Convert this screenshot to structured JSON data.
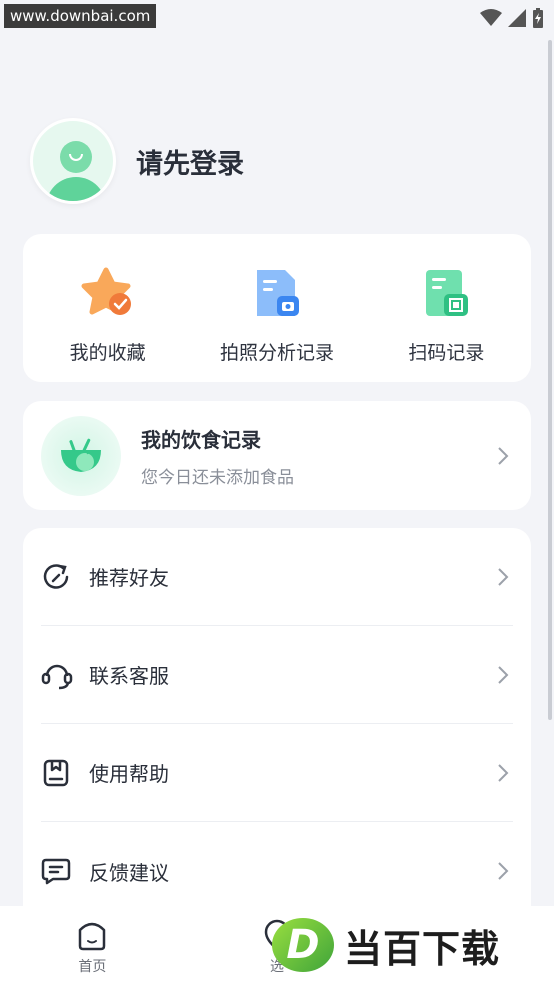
{
  "watermark_top": "www.downbai.com",
  "profile": {
    "login_text": "请先登录"
  },
  "shortcuts": [
    {
      "label": "我的收藏",
      "icon": "star-check-icon"
    },
    {
      "label": "拍照分析记录",
      "icon": "photo-doc-icon"
    },
    {
      "label": "扫码记录",
      "icon": "scan-doc-icon"
    }
  ],
  "diet": {
    "title": "我的饮食记录",
    "subtitle": "您今日还未添加食品",
    "icon": "food-bowl-icon"
  },
  "menu": [
    {
      "label": "推荐好友",
      "icon": "share-refresh-icon"
    },
    {
      "label": "联系客服",
      "icon": "headset-icon"
    },
    {
      "label": "使用帮助",
      "icon": "bookmark-book-icon"
    },
    {
      "label": "反馈建议",
      "icon": "message-icon"
    }
  ],
  "bottom_nav": [
    {
      "label": "首页",
      "icon": "home-face-icon"
    },
    {
      "label": "选",
      "icon": "location-icon"
    }
  ],
  "watermark_bottom": {
    "logo": "D",
    "text": "当百下载"
  },
  "colors": {
    "accent_green": "#3ecf8e",
    "background": "#f3f4f8",
    "orange": "#f7894a",
    "blue": "#4e93f2"
  }
}
